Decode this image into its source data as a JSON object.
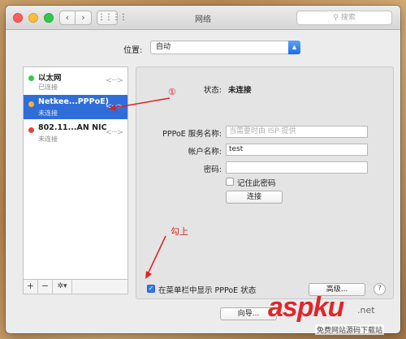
{
  "window": {
    "title": "网络",
    "search_placeholder": "搜索"
  },
  "location": {
    "label": "位置:",
    "value": "自动"
  },
  "services": [
    {
      "name": "以太网",
      "status": "已连接",
      "color": "#34c84a",
      "selected": false
    },
    {
      "name": "Netkee...PPPoE)",
      "status": "未连接",
      "color": "#f2b33a",
      "selected": true
    },
    {
      "name": "802.11...AN NIC",
      "status": "未连接",
      "color": "#e8403a",
      "selected": false
    }
  ],
  "sidebar_tools": {
    "add": "+",
    "remove": "−",
    "gear": "✲▾"
  },
  "detail": {
    "status_label": "状态:",
    "status_value": "未连接",
    "service_name_label": "PPPoE 服务名称:",
    "service_name_placeholder": "当需要时由 ISP 提供",
    "account_label": "帐户名称:",
    "account_value": "test",
    "password_label": "密码:",
    "remember_label": "记住此密码",
    "connect_button": "连接",
    "show_menu_label": "在菜单栏中显示 PPPoE 状态",
    "advanced_button": "高级...",
    "help": "?"
  },
  "footer": {
    "assist_button": "向导..."
  },
  "annotations": {
    "circle_one": "①",
    "tick_note": "勾上"
  },
  "watermark": {
    "brand": "aspku",
    "suffix": ".net",
    "tagline": "免费网站源码下载站"
  },
  "colors": {
    "selection": "#2f6ed8",
    "annotation": "#e02020",
    "checkbox_on": "#2f78ea"
  }
}
